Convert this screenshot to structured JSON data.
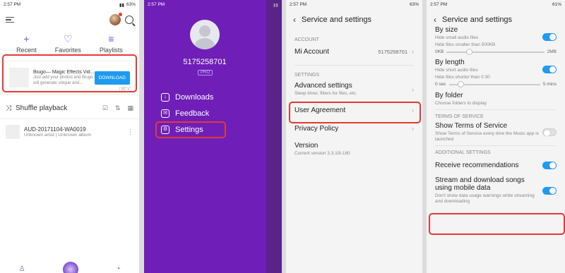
{
  "panel1": {
    "time": "2:57 PM",
    "battery": "63%",
    "tabs": [
      {
        "label": "Recent",
        "icon": "+"
      },
      {
        "label": "Favorites",
        "icon": "♡"
      },
      {
        "label": "Playlists",
        "icon": "≡"
      }
    ],
    "ad": {
      "title": "Biugo— Magic Effects Vid...",
      "desc": "Just add your photos and Biugo will generate unique and...",
      "button": "DOWNLOAD",
      "tag": "AD ✕"
    },
    "shuffle_label": "Shuffle playback",
    "song": {
      "title": "AUD-20171104-WA0019",
      "sub": "Unknown artist | Unknown album"
    }
  },
  "panel2": {
    "time": "2:57 PM",
    "user_id": "5175258701",
    "pro_badge": "PRO",
    "menu": [
      {
        "label": "Downloads",
        "icon": "↓"
      },
      {
        "label": "Feedback",
        "icon": "✉"
      },
      {
        "label": "Settings",
        "icon": "⚙"
      }
    ]
  },
  "panel3": {
    "time": "2:57 PM",
    "battery": "63%",
    "title": "Service and settings",
    "account_header": "ACCOUNT",
    "mi_account": {
      "label": "Mi Account",
      "value": "5175258701"
    },
    "settings_header": "SETTINGS",
    "advanced": {
      "label": "Advanced settings",
      "sub": "Sleep timer, filters for files, etc."
    },
    "user_agreement": "User Agreement",
    "privacy_policy": "Privacy Policy",
    "version": {
      "label": "Version",
      "sub": "Current version 3.3.10i-180"
    }
  },
  "panel4": {
    "time": "2:57 PM",
    "battery": "61%",
    "title": "Service and settings",
    "by_size": {
      "label": "By size",
      "sub": "Hide small audio files",
      "sub2": "Hide files smaller than 500KB",
      "min": "0KB",
      "max": "2MB",
      "on": true
    },
    "by_length": {
      "label": "By length",
      "sub": "Hide short audio files",
      "sub2": "Hide files shorter than 0:30",
      "min": "0 sec",
      "max": "5 mins",
      "on": true
    },
    "by_folder": {
      "label": "By folder",
      "sub": "Choose folders to display"
    },
    "tos_header": "TERMS OF SERVICE",
    "show_tos": {
      "label": "Show Terms of Service",
      "sub": "Show Terms of Service every time the Music app is launched",
      "on": false
    },
    "additional_header": "ADDITIONAL SETTINGS",
    "receive_recs": {
      "label": "Receive recommendations",
      "on": true
    },
    "stream": {
      "label": "Stream and download songs using mobile data",
      "sub": "Don't show data usage warnings while streaming and downloading",
      "on": true
    }
  }
}
